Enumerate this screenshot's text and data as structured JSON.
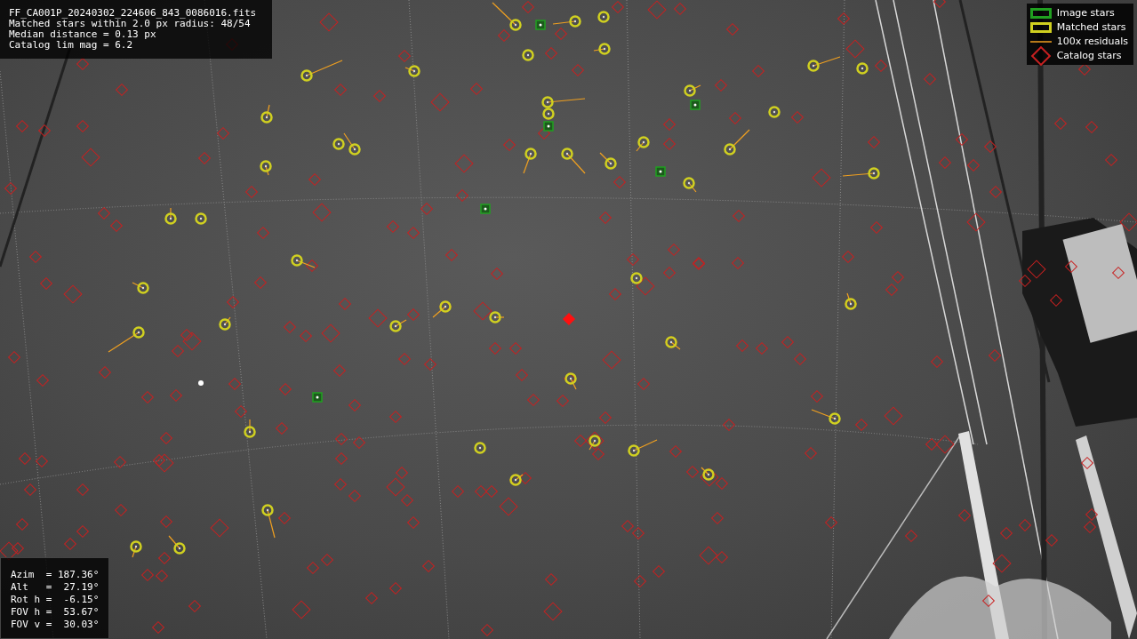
{
  "info_lines": [
    "FF_CA001P_20240302_224606_843_0086016.fits",
    "Matched stars within 2.0 px radius: 48/54",
    "Median distance = 0.13 px",
    "Catalog lim mag = 6.2"
  ],
  "legend": [
    {
      "kind": "image",
      "label": "Image stars"
    },
    {
      "kind": "matched",
      "label": "Matched stars"
    },
    {
      "kind": "residual",
      "label": "100x residuals"
    },
    {
      "kind": "catalog",
      "label": "Catalog stars"
    }
  ],
  "pointing_lines": [
    "Azim  = 187.36°",
    "Alt   =  27.19°",
    "Rot h =  -6.15°",
    "FOV h =  53.67°",
    "FOV v =  30.03°"
  ]
}
